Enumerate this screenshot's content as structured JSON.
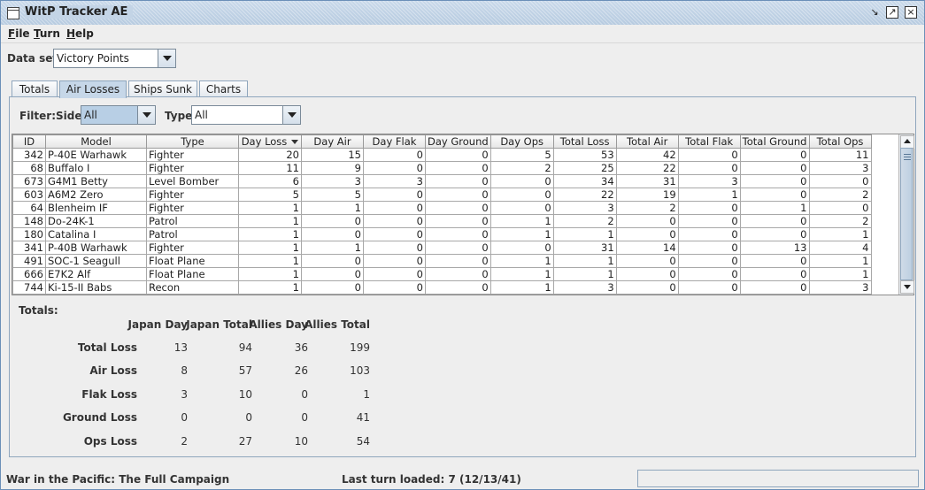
{
  "window": {
    "title": "WitP Tracker AE",
    "icon": "app-window-icon"
  },
  "menu": [
    {
      "label": "File",
      "mnemonic": "F",
      "rest": "ile"
    },
    {
      "label": "Turn",
      "mnemonic": "T",
      "rest": "urn"
    },
    {
      "label": "Help",
      "mnemonic": "H",
      "rest": "elp"
    }
  ],
  "dataset": {
    "label": "Data set:",
    "value": "Victory Points"
  },
  "tabs": [
    "Totals",
    "Air Losses",
    "Ships Sunk",
    "Charts"
  ],
  "active_tab": "Air Losses",
  "filter": {
    "label": "Filter:",
    "side_label": "Side:",
    "side_value": "All",
    "type_label": "Type:",
    "type_value": "All"
  },
  "table": {
    "columns": [
      "ID",
      "Model",
      "Type",
      "Day Loss",
      "Day Air",
      "Day Flak",
      "Day Ground",
      "Day Ops",
      "Total Loss",
      "Total Air",
      "Total Flak",
      "Total Ground",
      "Total Ops"
    ],
    "sorted_column": "Day Loss",
    "rows": [
      [
        "342",
        "P-40E Warhawk",
        "Fighter",
        "20",
        "15",
        "0",
        "0",
        "5",
        "53",
        "42",
        "0",
        "0",
        "11"
      ],
      [
        "68",
        "Buffalo I",
        "Fighter",
        "11",
        "9",
        "0",
        "0",
        "2",
        "25",
        "22",
        "0",
        "0",
        "3"
      ],
      [
        "673",
        "G4M1 Betty",
        "Level Bomber",
        "6",
        "3",
        "3",
        "0",
        "0",
        "34",
        "31",
        "3",
        "0",
        "0"
      ],
      [
        "603",
        "A6M2 Zero",
        "Fighter",
        "5",
        "5",
        "0",
        "0",
        "0",
        "22",
        "19",
        "1",
        "0",
        "2"
      ],
      [
        "64",
        "Blenheim IF",
        "Fighter",
        "1",
        "1",
        "0",
        "0",
        "0",
        "3",
        "2",
        "0",
        "1",
        "0"
      ],
      [
        "148",
        "Do-24K-1",
        "Patrol",
        "1",
        "0",
        "0",
        "0",
        "1",
        "2",
        "0",
        "0",
        "0",
        "2"
      ],
      [
        "180",
        "Catalina I",
        "Patrol",
        "1",
        "0",
        "0",
        "0",
        "1",
        "1",
        "0",
        "0",
        "0",
        "1"
      ],
      [
        "341",
        "P-40B Warhawk",
        "Fighter",
        "1",
        "1",
        "0",
        "0",
        "0",
        "31",
        "14",
        "0",
        "13",
        "4"
      ],
      [
        "491",
        "SOC-1 Seagull",
        "Float Plane",
        "1",
        "0",
        "0",
        "0",
        "1",
        "1",
        "0",
        "0",
        "0",
        "1"
      ],
      [
        "666",
        "E7K2 Alf",
        "Float Plane",
        "1",
        "0",
        "0",
        "0",
        "1",
        "1",
        "0",
        "0",
        "0",
        "1"
      ],
      [
        "744",
        "Ki-15-II Babs",
        "Recon",
        "1",
        "0",
        "0",
        "0",
        "1",
        "3",
        "0",
        "0",
        "0",
        "3"
      ]
    ]
  },
  "totals": {
    "title": "Totals:",
    "columns": [
      "Japan Day",
      "Japan Total",
      "Allies Day",
      "Allies Total"
    ],
    "rows": [
      {
        "label": "Total Loss",
        "values": [
          "13",
          "94",
          "36",
          "199"
        ]
      },
      {
        "label": "Air Loss",
        "values": [
          "8",
          "57",
          "26",
          "103"
        ]
      },
      {
        "label": "Flak Loss",
        "values": [
          "3",
          "10",
          "0",
          "1"
        ]
      },
      {
        "label": "Ground Loss",
        "values": [
          "0",
          "0",
          "0",
          "41"
        ]
      },
      {
        "label": "Ops Loss",
        "values": [
          "2",
          "27",
          "10",
          "54"
        ]
      }
    ]
  },
  "status": {
    "left": "War in the Pacific: The Full Campaign",
    "middle": "Last turn loaded: 7 (12/13/41)",
    "right": ""
  }
}
